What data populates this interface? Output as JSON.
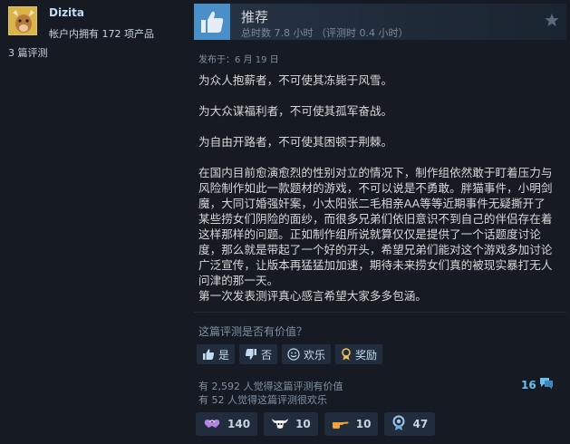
{
  "author": {
    "name": "Dizita",
    "products_owned": "帐户内拥有 172 项产品",
    "reviews_count": "3 篇评测"
  },
  "review": {
    "verdict": "推荐",
    "hours": "总时数 7.8 小时 （评测时 0.4 小时）",
    "posted": "发布于：6 月 19 日",
    "paragraphs": [
      "为众人抱薪者，不可使其冻毙于风雪。",
      "为大众谋福利者，不可使其孤军奋战。",
      "为自由开路者，不可使其困顿于荆棘。",
      "在国内目前愈演愈烈的性别对立的情况下，制作组依然敢于盯着压力与风险制作如此一款题材的游戏，不可以说是不勇敢。胖猫事件，小明剑魔，大同订婚强奸案，小太阳张二毛相亲AA等等近期事件无疑撕开了某些捞女们阴险的面纱，而很多兄弟们依旧意识不到自己的伴侣存在着这样那样的问题。正如制作组所说就算仅仅是提供了一个话题度讨论度，那么就是带起了一个好的开头，希望兄弟们能对这个游戏多加讨论广泛宣传，让版本再猛猛加加速，期待未来捞女们真的被现实暴打无人问津的那一天。",
      "第一次发表测评真心感言希望大家多多包涵。"
    ]
  },
  "feedback": {
    "question": "这篇评测是否有价值？",
    "yes_label": "是",
    "no_label": "否",
    "funny_label": "欢乐",
    "award_label": "奖励",
    "helpful_stat": "有 2,592 人觉得这篇评测有价值",
    "funny_stat": "有 52 人觉得这篇评测很欢乐",
    "comments_count": "16"
  },
  "awards": [
    {
      "icon": "heart-hands-icon",
      "count": "140"
    },
    {
      "icon": "cow-skull-icon",
      "count": "10"
    },
    {
      "icon": "pointing-hand-icon",
      "count": "10"
    },
    {
      "icon": "medal-icon",
      "count": "47"
    }
  ],
  "colors": {
    "background": "#161b23",
    "thumb_accent": "#4a8fc7",
    "link_blue": "#66c0f4"
  }
}
